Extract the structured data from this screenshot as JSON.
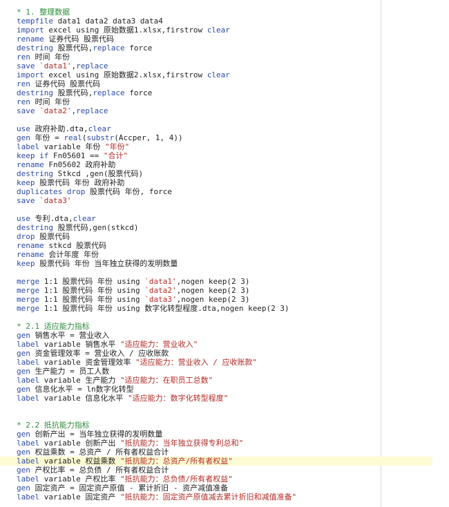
{
  "editor": {
    "highlight_colors": {
      "comment": "#2e8b3a",
      "keyword": "#2a4aa8",
      "string": "#b42a24",
      "plain": "#1f1f1f",
      "current_line": "#fdfbd3"
    },
    "current_line_index": 50,
    "lines": [
      [
        [
          "c",
          "* 1. 整理数据"
        ]
      ],
      [
        [
          "k",
          "tempfile"
        ],
        [
          "p",
          " data1 data2 data3 data4"
        ]
      ],
      [
        [
          "k",
          "import"
        ],
        [
          "p",
          " excel using 原始数据1.xlsx,firstrow "
        ],
        [
          "k",
          "clear"
        ]
      ],
      [
        [
          "k",
          "rename"
        ],
        [
          "p",
          " 证券代码 股票代码"
        ]
      ],
      [
        [
          "k",
          "destring"
        ],
        [
          "p",
          " 股票代码,"
        ],
        [
          "k",
          "replace"
        ],
        [
          "p",
          " force"
        ]
      ],
      [
        [
          "k",
          "ren"
        ],
        [
          "p",
          " 时间 年份"
        ]
      ],
      [
        [
          "k",
          "save"
        ],
        [
          "p",
          " "
        ],
        [
          "s",
          "`data1'"
        ],
        [
          "p",
          ","
        ],
        [
          "k",
          "replace"
        ]
      ],
      [
        [
          "k",
          "import"
        ],
        [
          "p",
          " excel using 原始数据2.xlsx,firstrow "
        ],
        [
          "k",
          "clear"
        ]
      ],
      [
        [
          "k",
          "ren"
        ],
        [
          "p",
          " 证券代码 股票代码"
        ]
      ],
      [
        [
          "k",
          "destring"
        ],
        [
          "p",
          " 股票代码,"
        ],
        [
          "k",
          "replace"
        ],
        [
          "p",
          " force"
        ]
      ],
      [
        [
          "k",
          "ren"
        ],
        [
          "p",
          " 时间 年份"
        ]
      ],
      [
        [
          "k",
          "save"
        ],
        [
          "p",
          " "
        ],
        [
          "s",
          "`data2'"
        ],
        [
          "p",
          ","
        ],
        [
          "k",
          "replace"
        ]
      ],
      [],
      [
        [
          "k",
          "use"
        ],
        [
          "p",
          " 政府补助.dta,"
        ],
        [
          "k",
          "clear"
        ]
      ],
      [
        [
          "k",
          "gen"
        ],
        [
          "p",
          " 年份 = "
        ],
        [
          "k",
          "real"
        ],
        [
          "p",
          "("
        ],
        [
          "k",
          "substr"
        ],
        [
          "p",
          "(Accper, 1, 4))"
        ]
      ],
      [
        [
          "k",
          "label"
        ],
        [
          "p",
          " variable 年份 "
        ],
        [
          "s",
          "\"年份\""
        ]
      ],
      [
        [
          "k",
          "keep if"
        ],
        [
          "p",
          " Fn05601 == "
        ],
        [
          "s",
          "\"合计\""
        ]
      ],
      [
        [
          "k",
          "rename"
        ],
        [
          "p",
          " Fn05602 政府补助"
        ]
      ],
      [
        [
          "k",
          "destring"
        ],
        [
          "p",
          " Stkcd ,gen(股票代码)"
        ]
      ],
      [
        [
          "k",
          "keep"
        ],
        [
          "p",
          " 股票代码 年份 政府补助"
        ]
      ],
      [
        [
          "k",
          "duplicates drop"
        ],
        [
          "p",
          " 股票代码 年份, force"
        ]
      ],
      [
        [
          "k",
          "save"
        ],
        [
          "p",
          " "
        ],
        [
          "s",
          "`data3'"
        ]
      ],
      [],
      [
        [
          "k",
          "use"
        ],
        [
          "p",
          " 专利.dta,"
        ],
        [
          "k",
          "clear"
        ]
      ],
      [
        [
          "k",
          "destring"
        ],
        [
          "p",
          " 股票代码,gen(stkcd)"
        ]
      ],
      [
        [
          "k",
          "drop"
        ],
        [
          "p",
          " 股票代码"
        ]
      ],
      [
        [
          "k",
          "rename"
        ],
        [
          "p",
          " stkcd 股票代码"
        ]
      ],
      [
        [
          "k",
          "rename"
        ],
        [
          "p",
          " 会计年度 年份"
        ]
      ],
      [
        [
          "k",
          "keep"
        ],
        [
          "p",
          " 股票代码 年份 当年独立获得的发明数量"
        ]
      ],
      [],
      [
        [
          "k",
          "merge"
        ],
        [
          "p",
          " 1:1 股票代码 年份 using "
        ],
        [
          "s",
          "`data1'"
        ],
        [
          "p",
          ",nogen keep(2 3)"
        ]
      ],
      [
        [
          "k",
          "merge"
        ],
        [
          "p",
          " 1:1 股票代码 年份 using "
        ],
        [
          "s",
          "`data2'"
        ],
        [
          "p",
          ",nogen keep(2 3)"
        ]
      ],
      [
        [
          "k",
          "merge"
        ],
        [
          "p",
          " 1:1 股票代码 年份 using "
        ],
        [
          "s",
          "`data3'"
        ],
        [
          "p",
          ",nogen keep(2 3)"
        ]
      ],
      [
        [
          "k",
          "merge"
        ],
        [
          "p",
          " 1:1 股票代码 年份 using 数字化转型程度.dta,nogen keep(2 3)"
        ]
      ],
      [],
      [
        [
          "c",
          "* 2.1 适应能力指标"
        ]
      ],
      [
        [
          "k",
          "gen"
        ],
        [
          "p",
          " 销售水平 = 营业收入"
        ]
      ],
      [
        [
          "k",
          "label"
        ],
        [
          "p",
          " variable 销售水平 "
        ],
        [
          "s",
          "\"适应能力：营业收入\""
        ]
      ],
      [
        [
          "k",
          "gen"
        ],
        [
          "p",
          " 资金管理效率 = 营业收入 / 应收账款"
        ]
      ],
      [
        [
          "k",
          "label"
        ],
        [
          "p",
          " variable 资金管理效率 "
        ],
        [
          "s",
          "\"适应能力：营业收入 / 应收账款\""
        ]
      ],
      [
        [
          "k",
          "gen"
        ],
        [
          "p",
          " 生产能力 = 员工人数"
        ]
      ],
      [
        [
          "k",
          "label"
        ],
        [
          "p",
          " variable 生产能力 "
        ],
        [
          "s",
          "\"适应能力：在职员工总数\""
        ]
      ],
      [
        [
          "k",
          "gen"
        ],
        [
          "p",
          " 信息化水平 = ln数字化转型"
        ]
      ],
      [
        [
          "k",
          "label"
        ],
        [
          "p",
          " variable 信息化水平 "
        ],
        [
          "s",
          "\"适应能力：数字化转型程度\""
        ]
      ],
      [],
      [],
      [
        [
          "c",
          "* 2.2 抵抗能力指标"
        ]
      ],
      [
        [
          "k",
          "gen"
        ],
        [
          "p",
          " 创新产出 = 当年独立获得的发明数量"
        ]
      ],
      [
        [
          "k",
          "label"
        ],
        [
          "p",
          " variable 创新产出 "
        ],
        [
          "s",
          "\"抵抗能力：当年独立获得专利总和\""
        ]
      ],
      [
        [
          "k",
          "gen"
        ],
        [
          "p",
          " 权益乘数 = 总资产 / 所有者权益合计"
        ]
      ],
      [
        [
          "k",
          "label"
        ],
        [
          "p",
          " variable 权益乘数 "
        ],
        [
          "s",
          "\"抵抗能力：总资产/所有者权益\""
        ]
      ],
      [
        [
          "k",
          "gen"
        ],
        [
          "p",
          " 产权比率 = 总负债 / 所有者权益合计"
        ]
      ],
      [
        [
          "k",
          "label"
        ],
        [
          "p",
          " variable 产权比率 "
        ],
        [
          "s",
          "\"抵抗能力：总负债/所有者权益\""
        ]
      ],
      [
        [
          "k",
          "gen"
        ],
        [
          "p",
          " 固定资产 = 固定资产原值 - 累计折旧 - 资产减值准备"
        ]
      ],
      [
        [
          "k",
          "label"
        ],
        [
          "p",
          " variable 固定资产 "
        ],
        [
          "s",
          "\"抵抗能力：固定资产原值减去累计折旧和减值准备\""
        ]
      ]
    ]
  }
}
